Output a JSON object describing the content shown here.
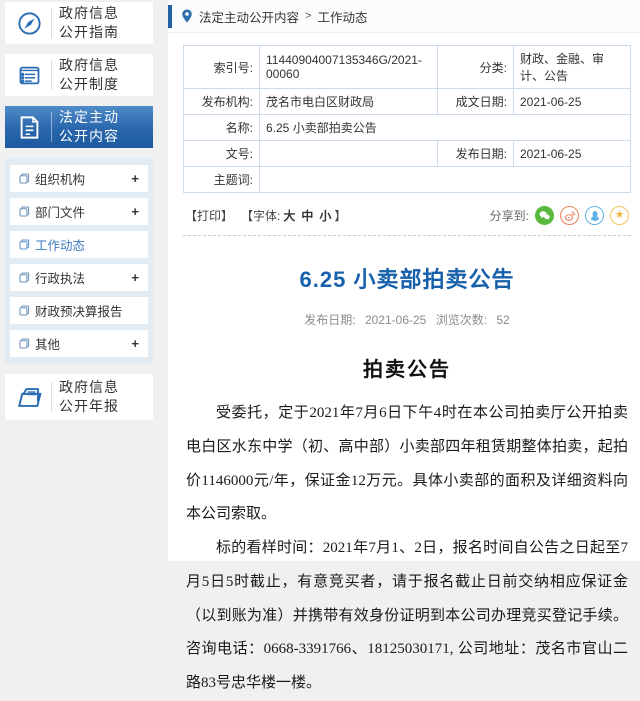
{
  "colors": {
    "accent_blue": "#1b5aa0",
    "title_blue": "#1760ab",
    "link_blue": "#3e7cc0",
    "table_border": "#ccdbe9",
    "wechat_green": "#5ab83d",
    "weibo_orange": "#e8825a",
    "qq_blue": "#5cb1e6",
    "star_yellow": "#f0b73e"
  },
  "sidebar": {
    "nav_guide": {
      "line1": "政府信息",
      "line2": "公开指南"
    },
    "nav_system": {
      "line1": "政府信息",
      "line2": "公开制度"
    },
    "nav_legal": {
      "line1": "法定主动",
      "line2": "公开内容"
    },
    "nav_annual": {
      "line1": "政府信息",
      "line2": "公开年报"
    },
    "submenu": [
      {
        "label": "组织机构",
        "expand": "+"
      },
      {
        "label": "部门文件",
        "expand": "+"
      },
      {
        "label": "工作动态",
        "expand": ""
      },
      {
        "label": "行政执法",
        "expand": "+"
      },
      {
        "label": "财政预决算报告",
        "expand": ""
      },
      {
        "label": "其他",
        "expand": "+"
      }
    ]
  },
  "breadcrumb": {
    "section": "法定主动公开内容",
    "separator": ">",
    "current": "工作动态"
  },
  "info_table": {
    "rows": [
      {
        "label1": "索引号:",
        "value1": "11440904007135346G/2021-00060",
        "label2": "分类:",
        "value2": "财政、金融、审计、公告"
      },
      {
        "label1": "发布机构:",
        "value1": "茂名市电白区财政局",
        "label2": "成文日期:",
        "value2": "2021-06-25"
      },
      {
        "label1": "名称:",
        "value1": "6.25 小卖部拍卖公告"
      },
      {
        "label1": "文号:",
        "value1": "",
        "label2": "发布日期:",
        "value2": "2021-06-25"
      },
      {
        "label1": "主题词:",
        "value1": ""
      }
    ]
  },
  "toolbar": {
    "print": "【打印】",
    "font_prefix": "【字体:",
    "font_large": "大",
    "font_medium": "中",
    "font_small": "小",
    "font_suffix": "】",
    "share_label": "分享到:",
    "star_glyph": "★"
  },
  "article": {
    "title": "6.25 小卖部拍卖公告",
    "date_label": "发布日期:",
    "date": "2021-06-25",
    "views_label": "浏览次数:",
    "views": "52",
    "heading": "拍卖公告",
    "paragraph1": "受委托，定于2021年7月6日下午4时在本公司拍卖厅公开拍卖电白区水东中学（初、高中部）小卖部四年租赁期整体拍卖，起拍价1146000元/年，保证金12万元。具体小卖部的面积及详细资料向本公司索取。",
    "paragraph2": "标的看样时间：2021年7月1、2日，报名时间自公告之日起至7月5日5时截止，有意竞买者，请于报名截止日前交纳相应保证金（以到账为准）并携带有效身份证明到本公司办理竞买登记手续。咨询电话：0668-3391766、18125030171, 公司地址：茂名市官山二路83号忠华楼一楼。"
  }
}
